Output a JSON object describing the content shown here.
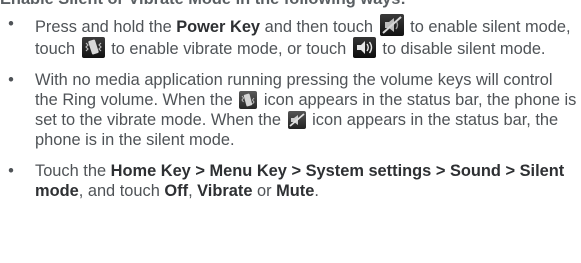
{
  "heading": "Enable Silent or Vibrate Mode in the following ways:",
  "icons": {
    "silent": "speaker-muted-icon",
    "vibrate": "phone-vibrate-icon",
    "sound": "speaker-on-icon",
    "status_vibrate": "vibrate-status-icon",
    "status_silent": "silent-status-icon"
  },
  "bullet_symbol": "•",
  "items": [
    {
      "t1": "Press and hold the ",
      "b1": "Power Key",
      "t2": " and then touch ",
      "t3": " to enable silent mode, touch ",
      "t4": " to enable vibrate mode, or touch ",
      "t5": " to disable silent mode."
    },
    {
      "t1": "With no media application running pressing the volume keys will control the Ring volume. When the ",
      "t2": " icon appears in the status bar, the phone is set to the vibrate mode. When the ",
      "t3": " icon appears in the status bar, the phone is in the silent mode."
    },
    {
      "t1": "Touch the ",
      "b1": "Home Key > Menu Key > System settings > Sound > Silent mode",
      "t2": ", and touch ",
      "b2": "Off",
      "t3": ", ",
      "b3": "Vibrate",
      "t4": " or ",
      "b4": "Mute",
      "t5": "."
    }
  ]
}
